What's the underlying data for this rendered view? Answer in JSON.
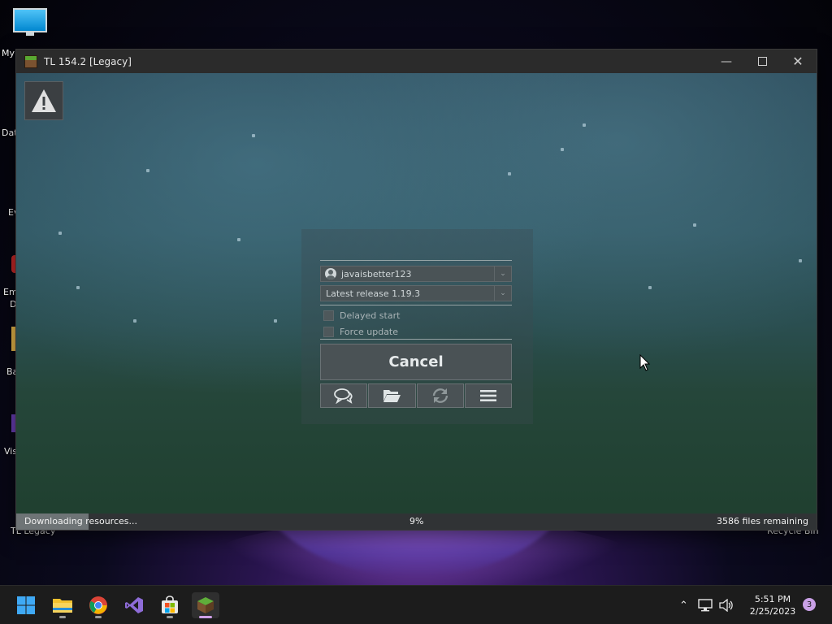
{
  "desktop": {
    "icons": [
      {
        "label": "My"
      },
      {
        "label": "Dat"
      },
      {
        "label": "Ev"
      },
      {
        "label": "Em"
      },
      {
        "label": "D"
      },
      {
        "label": "Ba"
      },
      {
        "label": "Vis"
      }
    ],
    "tl_legacy_label": "TL Legacy",
    "recycle_bin_label": "Recycle Bin"
  },
  "window": {
    "title": "TL 154.2 [Legacy]",
    "minimize_icon": "minimize-icon",
    "maximize_icon": "maximize-icon",
    "close_icon": "close-icon"
  },
  "launcher": {
    "account": "javaisbetter123",
    "version": "Latest release 1.19.3",
    "delayed_start_label": "Delayed start",
    "force_update_label": "Force update",
    "cancel_label": "Cancel",
    "toolbar_icons": [
      "chat-icon",
      "folder-icon",
      "refresh-icon",
      "menu-icon"
    ]
  },
  "status": {
    "left": "Downloading resources...",
    "percent": "9%",
    "progress_fraction": 0.09,
    "right": "3586 files remaining"
  },
  "taskbar": {
    "apps": [
      "windows-start-icon",
      "file-explorer-icon",
      "chrome-icon",
      "visual-studio-icon",
      "microsoft-store-icon",
      "tl-legacy-icon"
    ],
    "time": "5:51 PM",
    "date": "2/25/2023",
    "notification_count": "3"
  }
}
